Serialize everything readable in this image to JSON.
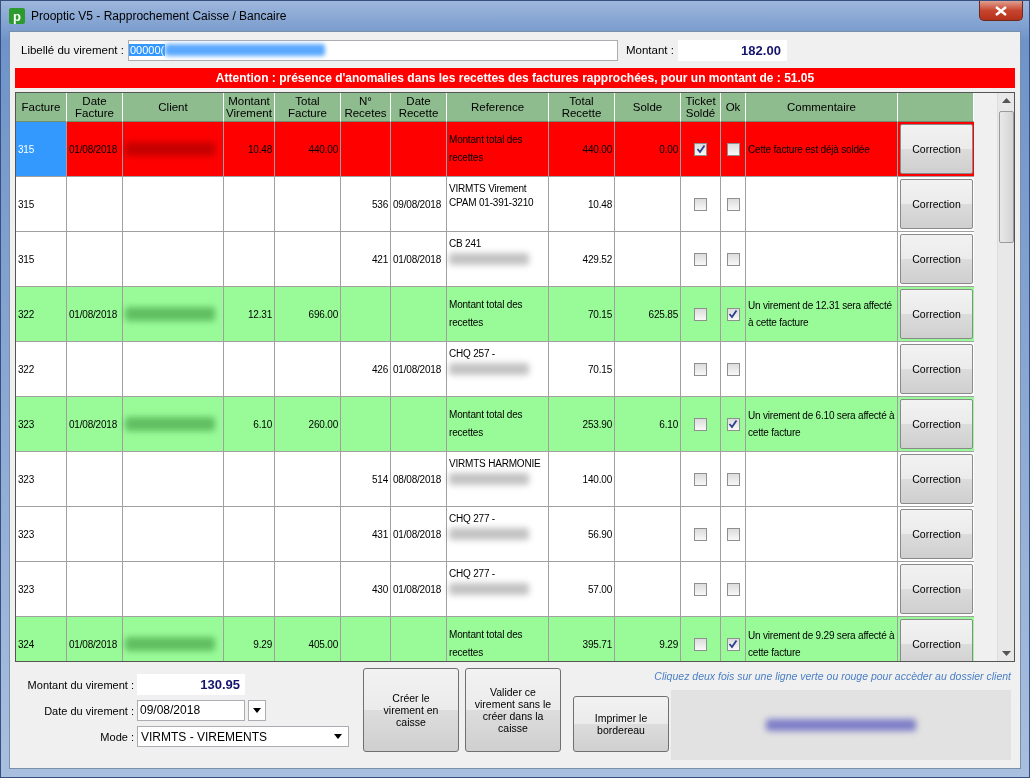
{
  "window": {
    "logo_letter": "p",
    "title": "Prooptic V5 - Rapprochement Caisse / Bancaire"
  },
  "header": {
    "libelle_label": "Libellé du virement :",
    "libelle_value": "00000(",
    "libelle_redacted": true,
    "montant_label": "Montant :",
    "montant_value": "182.00"
  },
  "alert": "Attention : présence d'anomalies dans les recettes des factures rapprochées, pour un montant de : 51.05",
  "table": {
    "columns": [
      "Facture",
      "Date Facture",
      "Client",
      "Montant Virement",
      "Total Facture",
      "N° Recetes",
      "Date Recette",
      "Reference",
      "Total Recette",
      "Solde",
      "Ticket Soldé",
      "Ok",
      "Commentaire"
    ],
    "rows": [
      {
        "kind": "total",
        "color": "#ff0000",
        "selected": true,
        "facture": "315",
        "date_facture": "01/08/2018",
        "client_redacted": true,
        "montant_virement": "10.48",
        "total_facture": "440.00",
        "num_recette": "",
        "date_recette": "",
        "reference": "Montant total des recettes",
        "reference_redacted": false,
        "total_recette": "440.00",
        "solde": "0.00",
        "ticket_solde": true,
        "ok": false,
        "commentaire": "Cette facture est déjà soldée",
        "button": "Correction"
      },
      {
        "kind": "detail",
        "color": "#ffffff",
        "selected": false,
        "facture": "315",
        "date_facture": "",
        "client_redacted": false,
        "montant_virement": "",
        "total_facture": "",
        "num_recette": "536",
        "date_recette": "09/08/2018",
        "reference": "VIRMTS Virement CPAM 01-391-3210",
        "reference_redacted": false,
        "total_recette": "10.48",
        "solde": "",
        "ticket_solde": false,
        "ok": false,
        "commentaire": "",
        "button": "Correction"
      },
      {
        "kind": "detail",
        "color": "#ffffff",
        "selected": false,
        "facture": "315",
        "date_facture": "",
        "client_redacted": false,
        "montant_virement": "",
        "total_facture": "",
        "num_recette": "421",
        "date_recette": "01/08/2018",
        "reference": "CB 241",
        "reference_redacted": true,
        "total_recette": "429.52",
        "solde": "",
        "ticket_solde": false,
        "ok": false,
        "commentaire": "",
        "button": "Correction"
      },
      {
        "kind": "total",
        "color": "#98fb98",
        "selected": false,
        "facture": "322",
        "date_facture": "01/08/2018",
        "client_redacted": true,
        "montant_virement": "12.31",
        "total_facture": "696.00",
        "num_recette": "",
        "date_recette": "",
        "reference": "Montant total des recettes",
        "reference_redacted": false,
        "total_recette": "70.15",
        "solde": "625.85",
        "ticket_solde": false,
        "ok": true,
        "commentaire": "Un virement de 12.31 sera affecté à cette facture",
        "button": "Correction"
      },
      {
        "kind": "detail",
        "color": "#ffffff",
        "selected": false,
        "facture": "322",
        "date_facture": "",
        "client_redacted": false,
        "montant_virement": "",
        "total_facture": "",
        "num_recette": "426",
        "date_recette": "01/08/2018",
        "reference": "CHQ 257 -",
        "reference_redacted": true,
        "total_recette": "70.15",
        "solde": "",
        "ticket_solde": false,
        "ok": false,
        "commentaire": "",
        "button": "Correction"
      },
      {
        "kind": "total",
        "color": "#98fb98",
        "selected": false,
        "facture": "323",
        "date_facture": "01/08/2018",
        "client_redacted": true,
        "montant_virement": "6.10",
        "total_facture": "260.00",
        "num_recette": "",
        "date_recette": "",
        "reference": "Montant total des recettes",
        "reference_redacted": false,
        "total_recette": "253.90",
        "solde": "6.10",
        "ticket_solde": false,
        "ok": true,
        "commentaire": "Un virement de 6.10 sera affecté à cette facture",
        "button": "Correction"
      },
      {
        "kind": "detail",
        "color": "#ffffff",
        "selected": false,
        "facture": "323",
        "date_facture": "",
        "client_redacted": false,
        "montant_virement": "",
        "total_facture": "",
        "num_recette": "514",
        "date_recette": "08/08/2018",
        "reference": "VIRMTS HARMONIE",
        "reference_redacted": true,
        "total_recette": "140.00",
        "solde": "",
        "ticket_solde": false,
        "ok": false,
        "commentaire": "",
        "button": "Correction"
      },
      {
        "kind": "detail",
        "color": "#ffffff",
        "selected": false,
        "facture": "323",
        "date_facture": "",
        "client_redacted": false,
        "montant_virement": "",
        "total_facture": "",
        "num_recette": "431",
        "date_recette": "01/08/2018",
        "reference": "CHQ 277 -",
        "reference_redacted": true,
        "total_recette": "56.90",
        "solde": "",
        "ticket_solde": false,
        "ok": false,
        "commentaire": "",
        "button": "Correction"
      },
      {
        "kind": "detail",
        "color": "#ffffff",
        "selected": false,
        "facture": "323",
        "date_facture": "",
        "client_redacted": false,
        "montant_virement": "",
        "total_facture": "",
        "num_recette": "430",
        "date_recette": "01/08/2018",
        "reference": "CHQ 277 -",
        "reference_redacted": true,
        "total_recette": "57.00",
        "solde": "",
        "ticket_solde": false,
        "ok": false,
        "commentaire": "",
        "button": "Correction"
      },
      {
        "kind": "total",
        "color": "#98fb98",
        "selected": false,
        "facture": "324",
        "date_facture": "01/08/2018",
        "client_redacted": true,
        "montant_virement": "9.29",
        "total_facture": "405.00",
        "num_recette": "",
        "date_recette": "",
        "reference": "Montant total des recettes",
        "reference_redacted": false,
        "total_recette": "395.71",
        "solde": "9.29",
        "ticket_solde": false,
        "ok": true,
        "commentaire": "Un virement de 9.29 sera affecté à cette facture",
        "button": "Correction"
      }
    ]
  },
  "footer": {
    "montant_label": "Montant  du virement :",
    "montant_value": "130.95",
    "date_label": "Date du virement :",
    "date_value": "09/08/2018",
    "mode_label": "Mode :",
    "mode_value": "VIRMTS - VIREMENTS",
    "buttons": [
      "Créer le virement en caisse",
      "Valider ce virement sans le créer dans la caisse",
      "Imprimer le bordereau"
    ],
    "hint": "Cliquez deux fois sur une ligne verte ou rouge pour accèder au dossier client",
    "panel_redacted": true
  }
}
